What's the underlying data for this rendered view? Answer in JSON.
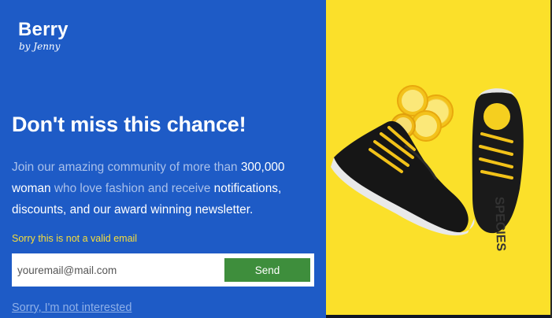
{
  "brand": {
    "name": "Berry",
    "tagline": "by Jenny"
  },
  "headline": "Don't miss this chance!",
  "body": {
    "p1": "Join our amazing community of more than ",
    "h1": "300,000 woman",
    "p2": " who love fashion and receive ",
    "h2": "notifications, discounts, and our award winning newsletter."
  },
  "error_message": "Sorry this is not a valid email",
  "form": {
    "email_placeholder": "youremail@mail.com",
    "send_label": "Send"
  },
  "decline_link": "Sorry, I'm not interested",
  "colors": {
    "left_panel": "#1e5bc6",
    "right_panel": "#fbe02a",
    "send_button": "#3e8e3c",
    "error_text": "#f7dd3a",
    "link_text": "#8fb0e8"
  }
}
